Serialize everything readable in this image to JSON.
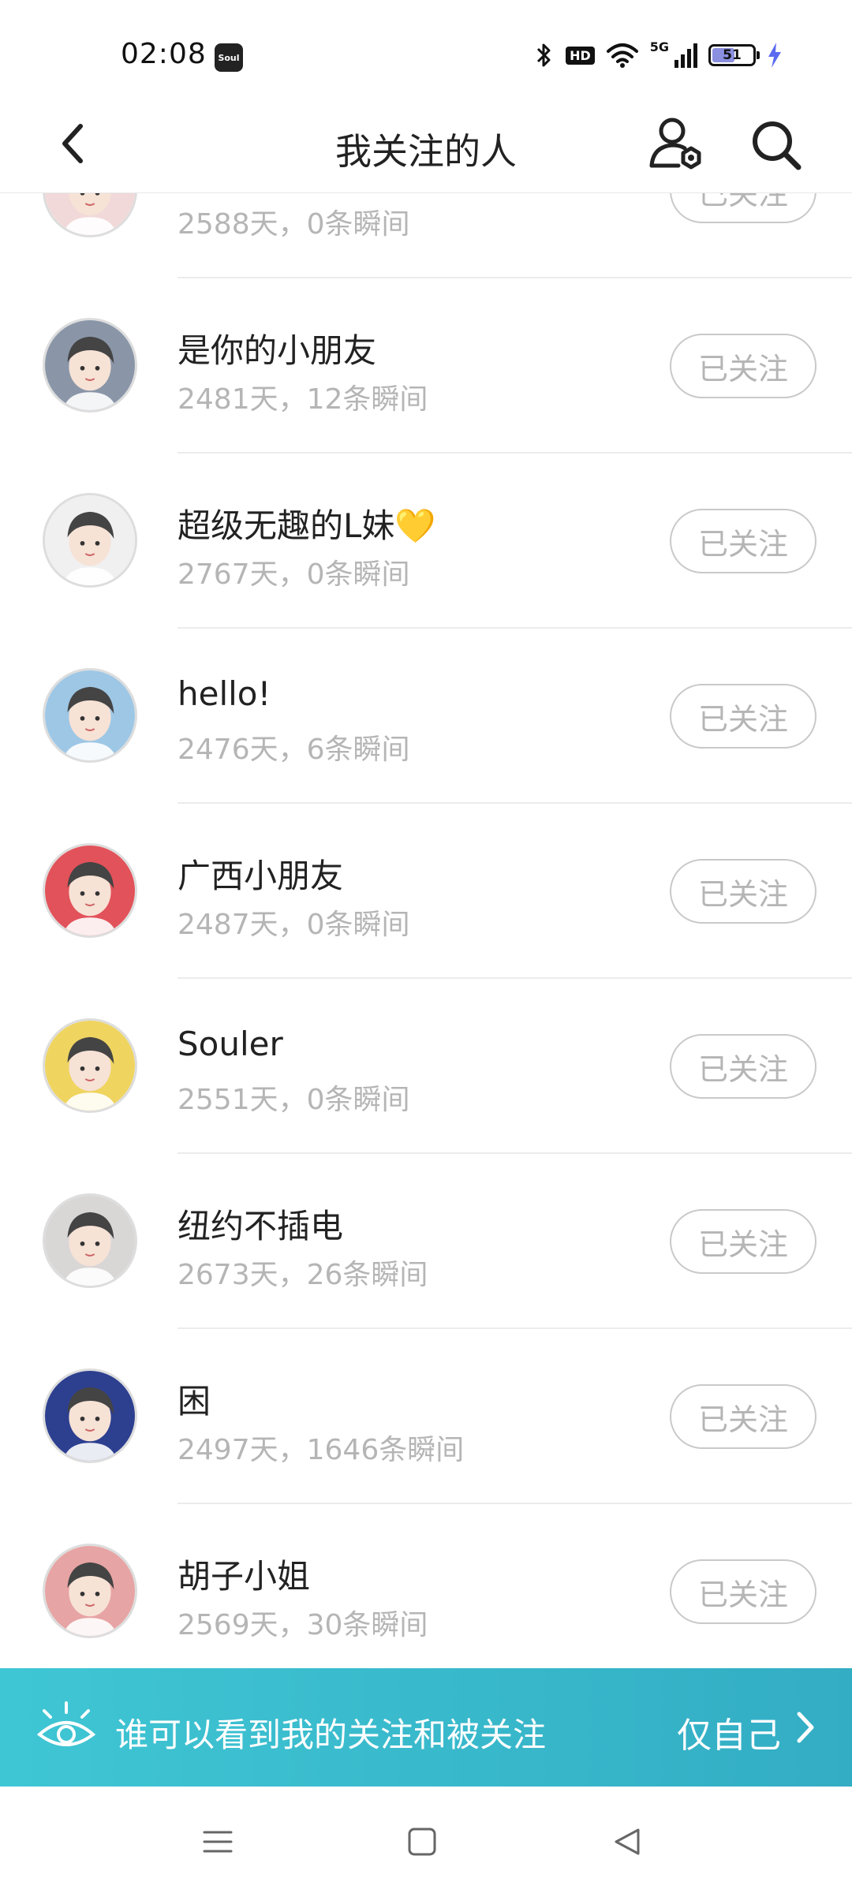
{
  "status_bar": {
    "time": "02:08",
    "app_badge": "Soul",
    "hd": "HD",
    "network": "5G",
    "battery": "51"
  },
  "header": {
    "title": "我关注的人"
  },
  "following": [
    {
      "name": "",
      "meta": "2588天，0条瞬间",
      "button": "已关注",
      "avatar_color": "#f2d9d9"
    },
    {
      "name": "是你的小朋友",
      "meta": "2481天，12条瞬间",
      "button": "已关注",
      "avatar_color": "#8a96a8"
    },
    {
      "name": "超级无趣的L妹💛",
      "meta": "2767天，0条瞬间",
      "button": "已关注",
      "avatar_color": "#f0f0f0"
    },
    {
      "name": "hello!",
      "meta": "2476天，6条瞬间",
      "button": "已关注",
      "avatar_color": "#9ec7e6"
    },
    {
      "name": "广西小朋友",
      "meta": "2487天，0条瞬间",
      "button": "已关注",
      "avatar_color": "#e2525a"
    },
    {
      "name": "Souler",
      "meta": "2551天，0条瞬间",
      "button": "已关注",
      "avatar_color": "#efd460"
    },
    {
      "name": "纽约不插电",
      "meta": "2673天，26条瞬间",
      "button": "已关注",
      "avatar_color": "#d9d6d6"
    },
    {
      "name": "困",
      "meta": "2497天，1646条瞬间",
      "button": "已关注",
      "avatar_color": "#2d3f8f"
    },
    {
      "name": "胡子小姐",
      "meta": "2569天，30条瞬间",
      "button": "已关注",
      "avatar_color": "#e7a4a4"
    }
  ],
  "privacy": {
    "label": "谁可以看到我的关注和被关注",
    "value": "仅自己"
  },
  "colors": {
    "banner": "#3fc6d4",
    "button_border": "#c9c9c9",
    "meta_text": "#b5b5b5"
  }
}
